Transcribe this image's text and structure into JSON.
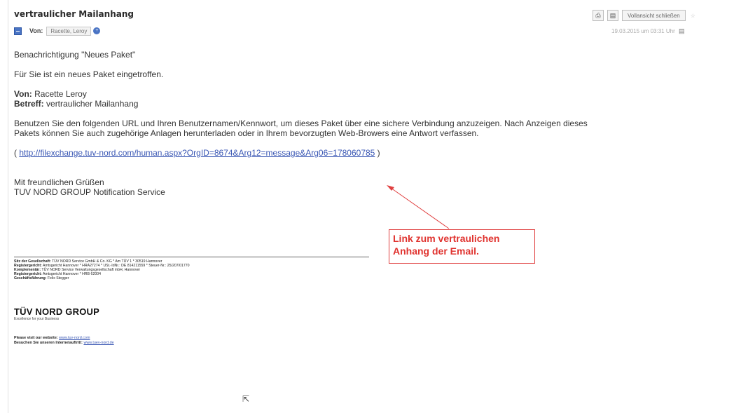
{
  "email": {
    "subject": "vertraulicher Mailanhang",
    "from_label": "Von:",
    "sender_chip": "Racette, Leroy",
    "date": "19.03.2015 um 03:31 Uhr"
  },
  "toolbar": {
    "print_icon": "printer-icon",
    "save_icon": "disk-icon",
    "close_label": "Vollansicht schließen"
  },
  "body": {
    "line1": "Benachrichtigung \"Neues Paket\"",
    "line2": "Für Sie ist ein neues Paket eingetroffen.",
    "from_key": "Von:",
    "from_val": "Racette Leroy",
    "subject_key": "Betreff:",
    "subject_val": "vertraulicher Mailanhang",
    "para_line1": "Benutzen Sie den folgenden URL und Ihren Benutzernamen/Kennwort, um dieses Paket über eine sichere Verbindung anzuzeigen. Nach Anzeigen dieses",
    "para_line2": "Pakets können Sie auch zugehörige Anlagen herunterladen oder in Ihrem bevorzugten Web-Browers eine Antwort verfassen.",
    "link_open": "( ",
    "link": "http://filexchange.tuv-nord.com/human.aspx?OrgID=8674&Arg12=message&Arg06=178060785",
    "link_close": " )",
    "greeting": "Mit freundlichen Grüßen",
    "signature": "TUV NORD GROUP Notification Service"
  },
  "footer": {
    "legal1_key": "Sitz der Gesellschaft:",
    "legal1_val": "TÜV NORD Service GmbH & Co. KG * Am TÜV 1 * 30519 Hannover",
    "legal2_key": "Registergericht:",
    "legal2_val": "Amtsgericht Hannover * HRA27274 * USt.-IdNr.: DE 814211559 * Steuer-Nr.: 25/207/01770",
    "legal3_key": "Komplementär:",
    "legal3_val": "TÜV NORD Service Verwaltungsgesellschaft mbH, Hannover",
    "legal4_key": "Registergericht:",
    "legal4_val": "Amtsgericht Hannover * HRB 62004",
    "legal5_key": "Geschäftsführung:",
    "legal5_val": "Felix Stegger",
    "company": "TÜV NORD GROUP",
    "tagline": "Excellence for your Business",
    "visit_label": "Please visit our website:",
    "visit_link": "www.tuv-nord.com",
    "visit2_label": "Besuchen Sie unseren Internetauftritt:",
    "visit2_link": "www.tuev-nord.de"
  },
  "annotation": {
    "line1": "Link zum vertraulichen",
    "line2": "Anhang der Email."
  }
}
